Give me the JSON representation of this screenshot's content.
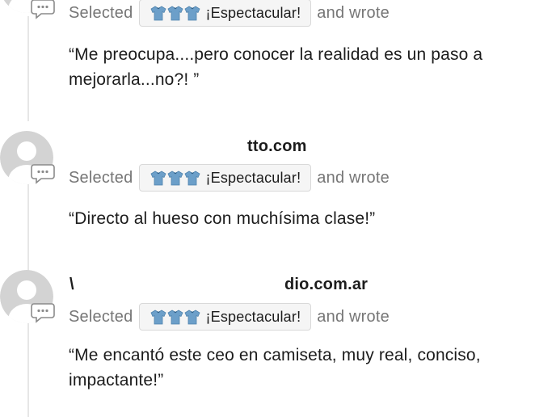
{
  "activity": [
    {
      "author": "",
      "action_prefix": "Selected",
      "reaction": {
        "icon": "jersey-icon",
        "label": "¡Espectacular!"
      },
      "action_suffix": "and wrote",
      "comment": "“Me preocupa....pero conocer la realidad es un paso a mejorarla...no?! ”"
    },
    {
      "author": "tto.com",
      "action_prefix": "Selected",
      "reaction": {
        "icon": "jersey-icon",
        "label": "¡Espectacular!"
      },
      "action_suffix": "and wrote",
      "comment": "“Directo al hueso con muchísima clase!”"
    },
    {
      "author_initial": "\\",
      "author": "dio.com.ar",
      "action_prefix": "Selected",
      "reaction": {
        "icon": "jersey-icon",
        "label": "¡Espectacular!"
      },
      "action_suffix": "and wrote",
      "comment": "“Me encantó este ceo en camiseta, muy real, conciso, impactante!”"
    }
  ],
  "colors": {
    "jersey": "#6c9fc9",
    "jersey_dark": "#4f83ad",
    "avatar_bg": "#d3d3d3",
    "avatar_fg": "#ffffff",
    "muted_text": "#767676",
    "chip_bg": "#f5f5f5",
    "thread_line": "#e6e6e6"
  }
}
